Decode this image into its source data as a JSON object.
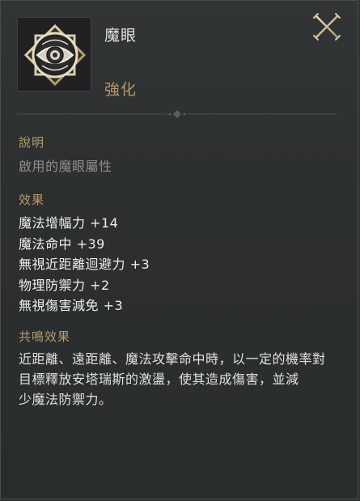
{
  "item": {
    "name": "魔眼",
    "grade": "強化",
    "icon": "eye-emblem-icon"
  },
  "close": {
    "icon": "crossed-swords-close-icon"
  },
  "description": {
    "heading": "說明",
    "text": "啟用的魔眼屬性"
  },
  "effects": {
    "heading": "效果",
    "items": [
      "魔法增幅力 +14",
      "魔法命中 +39",
      "無視近距離迴避力 +3",
      "物理防禦力 +2",
      "無視傷害減免 +3"
    ]
  },
  "resonance": {
    "heading": "共鳴效果",
    "lines": [
      "近距離、遠距離、魔法攻擊命中時，以一定的機率對",
      "目標釋放安塔瑞斯的激盪，使其造成傷害，並減",
      "少魔法防禦力。"
    ]
  },
  "colors": {
    "background": "#2e3132",
    "heading_gold": "#b39a6d",
    "text_light": "#f0eee8",
    "text_muted": "#8e8e8b"
  }
}
